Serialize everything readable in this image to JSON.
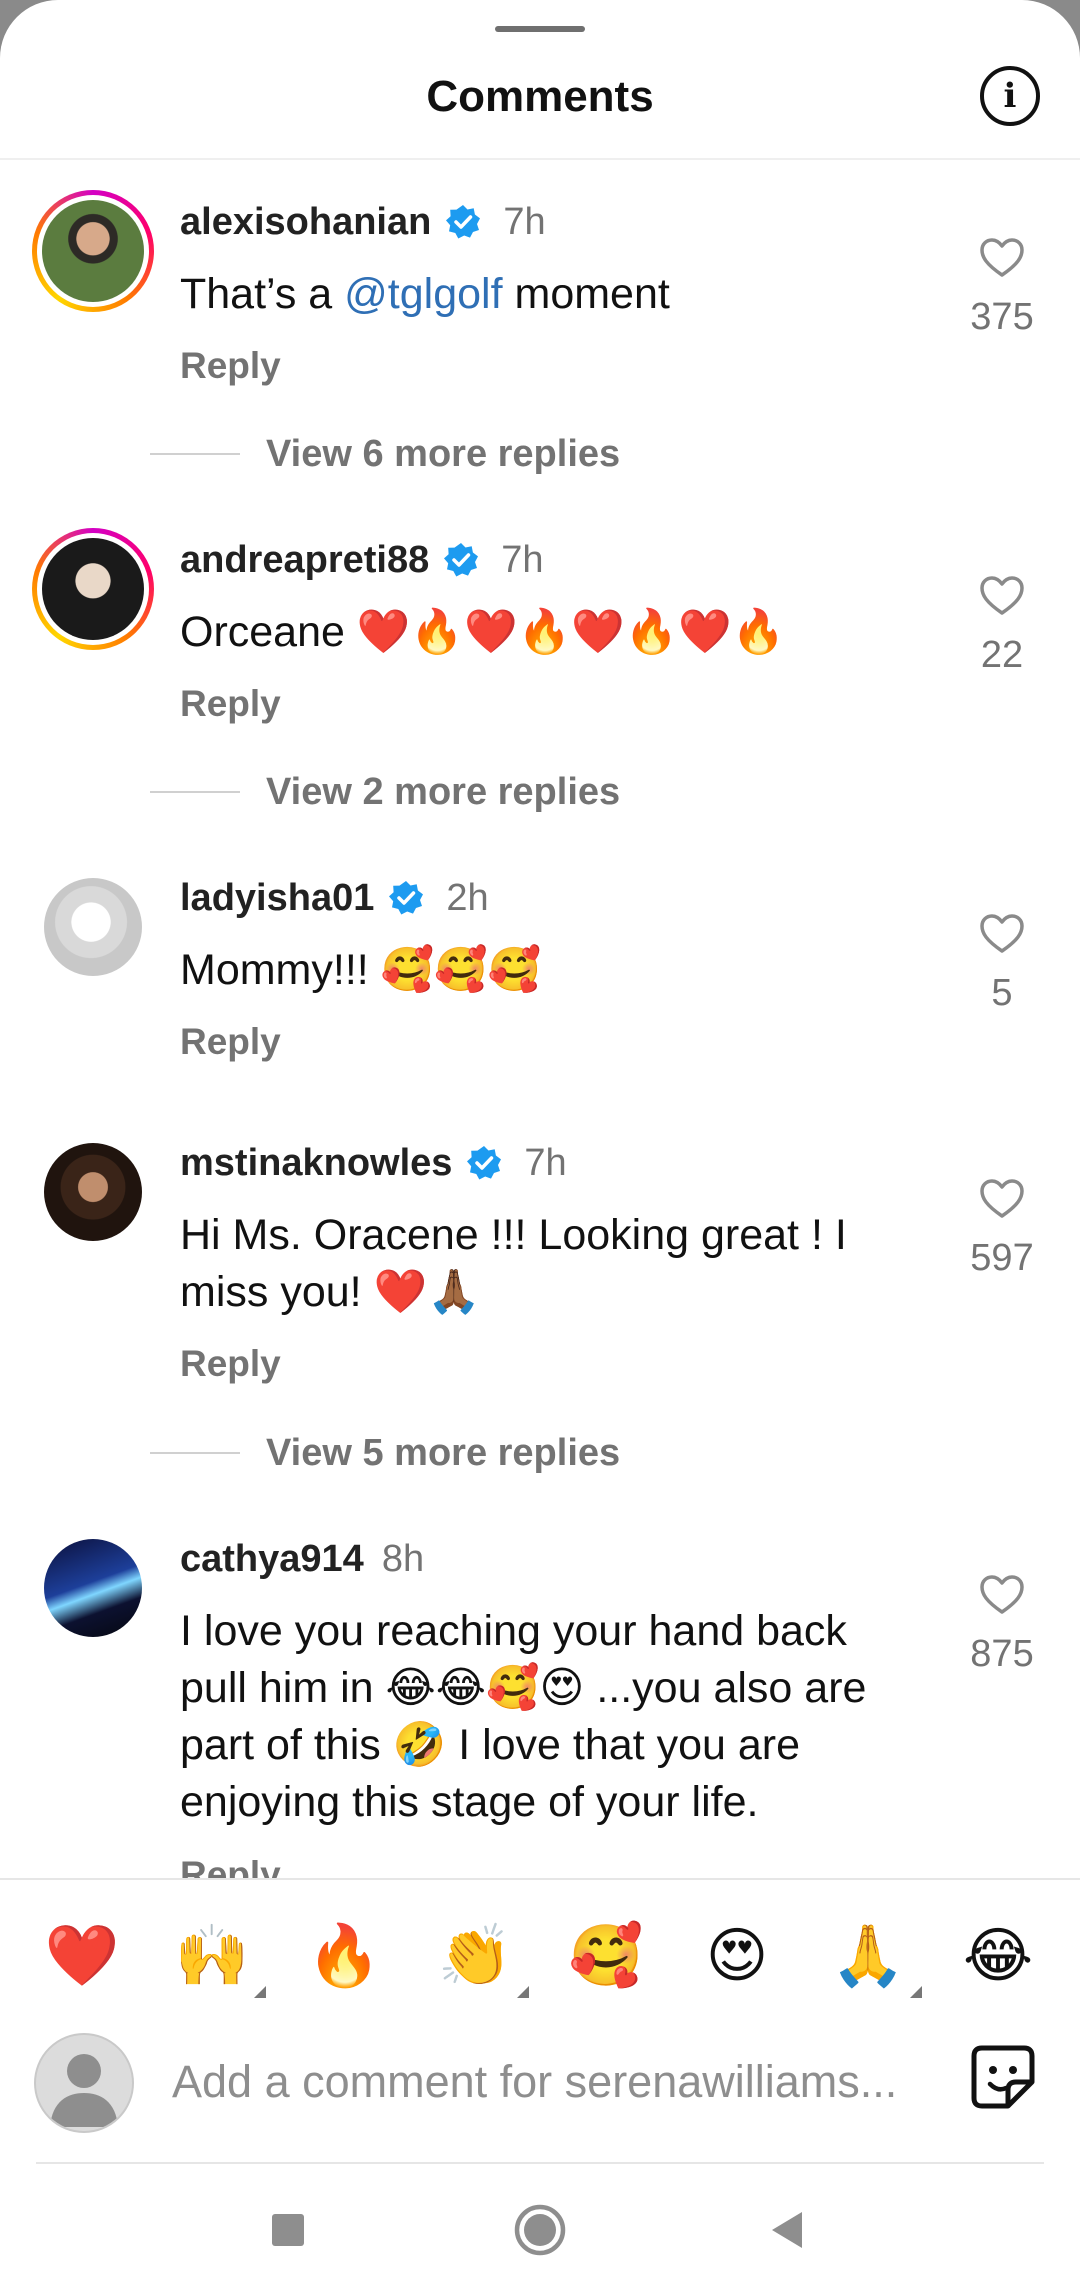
{
  "header": {
    "title": "Comments"
  },
  "comments": [
    {
      "username": "alexisohanian",
      "verified": true,
      "time": "7h",
      "text_before": "That’s a ",
      "mention": "@tglgolf",
      "text_after": " moment",
      "reply_label": "Reply",
      "likes": "375",
      "view_more": "View 6 more replies"
    },
    {
      "username": "andreapreti88",
      "verified": true,
      "time": "7h",
      "text": "Orceane ❤️🔥❤️🔥❤️🔥❤️🔥",
      "reply_label": "Reply",
      "likes": "22",
      "view_more": "View 2 more replies"
    },
    {
      "username": "ladyisha01",
      "verified": true,
      "time": "2h",
      "text": "Mommy!!! 🥰🥰🥰",
      "reply_label": "Reply",
      "likes": "5"
    },
    {
      "username": "mstinaknowles",
      "verified": true,
      "time": "7h",
      "text": "Hi Ms. Oracene !!! Looking great ! I miss you! ❤️🙏🏾",
      "reply_label": "Reply",
      "likes": "597",
      "view_more": "View 5 more replies"
    },
    {
      "username": "cathya914",
      "verified": false,
      "time": "8h",
      "text": "I love you reaching your hand back pull him in 😂😂🥰😍 ...you also are part of this 🤣 I love that you are enjoying this stage of your life.",
      "reply_label": "Reply",
      "likes": "875"
    }
  ],
  "emoji_bar": [
    {
      "emoji": "❤️",
      "icon": "red-heart-emoji"
    },
    {
      "emoji": "🙌",
      "icon": "raising-hands-emoji"
    },
    {
      "emoji": "🔥",
      "icon": "fire-emoji"
    },
    {
      "emoji": "👏",
      "icon": "clapping-hands-emoji"
    },
    {
      "emoji": "🥰",
      "icon": "smiling-face-with-hearts-emoji"
    },
    {
      "emoji": "😍",
      "icon": "heart-eyes-emoji"
    },
    {
      "emoji": "🙏",
      "icon": "folded-hands-emoji"
    },
    {
      "emoji": "😂",
      "icon": "tears-of-joy-emoji"
    }
  ],
  "composer": {
    "placeholder": "Add a comment for serenawilliams..."
  },
  "colors": {
    "verified": "#1d9bf0",
    "mention": "#2f6fb5",
    "secondary_text": "#737373"
  },
  "icons": {
    "info": "info-icon",
    "heart": "heart-outline-icon",
    "sticker": "sticker-icon",
    "nav": [
      "recents-square-icon",
      "home-circle-icon",
      "back-triangle-icon"
    ]
  }
}
